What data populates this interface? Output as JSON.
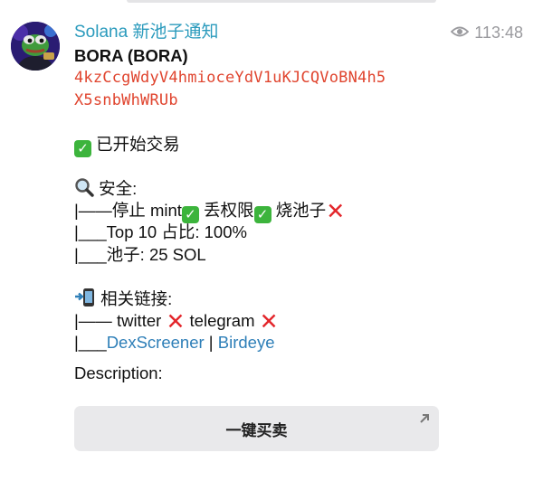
{
  "header": {
    "channel_name": "Solana 新池子通知",
    "time": "113:48"
  },
  "message": {
    "title": "BORA (BORA)",
    "address_line1": "4kzCcgWdyV4hmioceYdV1uKJCQVoBN4h5",
    "address_line2": "X5snbWhWRUb",
    "status": "已开始交易",
    "security_heading": "安全:",
    "security_row_prefix": "|——停止 mint",
    "security_row_mid": " 丢权限",
    "security_row_end": " 烧池子",
    "top10_line": "|___Top 10 占比:  100%",
    "pool_line": "|___池子:  25 SOL",
    "links_heading": "相关链接:",
    "links_row_prefix": "|—— twitter ",
    "links_row_mid": "  telegram ",
    "links_last_prefix": "|___",
    "link_dexscreener": "DexScreener",
    "link_sep": " | ",
    "link_birdeye": "Birdeye",
    "description_label": "Description:"
  },
  "inline_button": {
    "label": "一键买卖"
  },
  "icons": {
    "views": "eye-icon",
    "status": "check-mark-button-emoji",
    "security": "magnifying-glass-emoji",
    "links": "mobile-phone-arrow-emoji",
    "yes": "check-mark-emoji",
    "no": "cross-mark-emoji",
    "button": "arrow-up-right-icon"
  },
  "colors": {
    "channel": "#2b9bbd",
    "address": "#e0452f",
    "link": "#2e7fb8",
    "check": "#3cb43c",
    "cross": "#e3262b"
  }
}
